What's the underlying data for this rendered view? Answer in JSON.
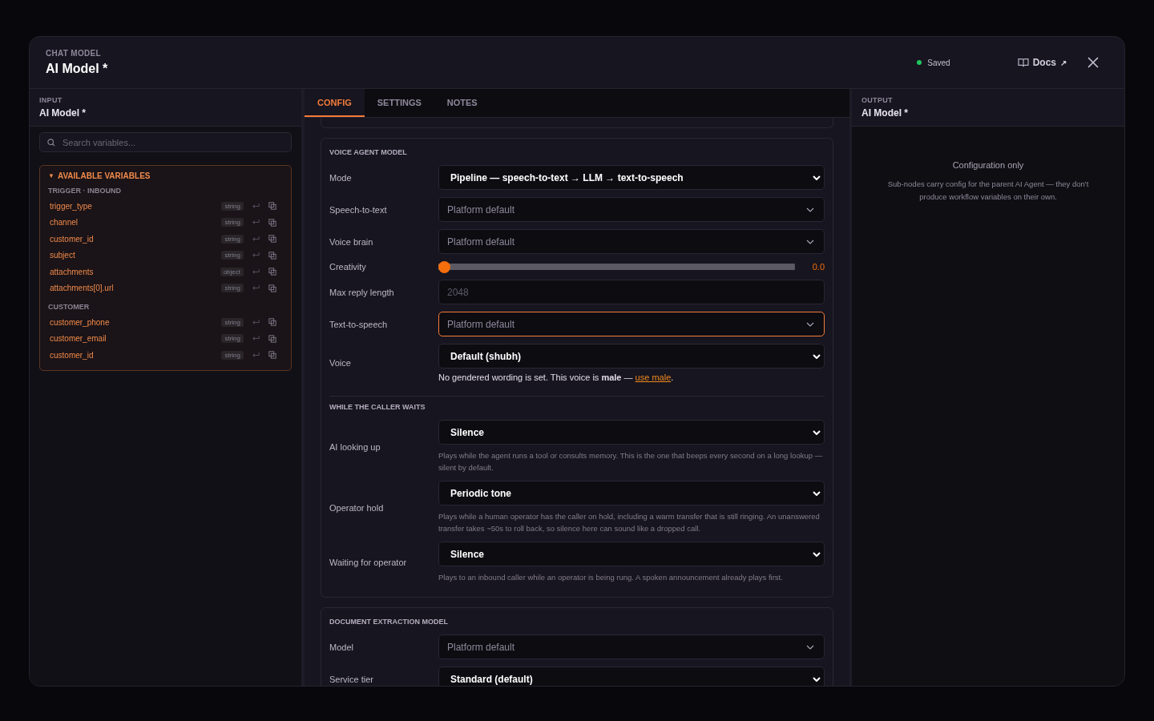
{
  "header": {
    "eyebrow": "CHAT MODEL",
    "title": "AI Model *",
    "status": {
      "label": "Saved",
      "color": "#22c55e"
    },
    "docs": {
      "label": "Docs",
      "arrow": "↗"
    }
  },
  "input_panel": {
    "eyebrow": "INPUT",
    "title": "AI Model *",
    "search": {
      "placeholder": "Search variables..."
    },
    "variables": {
      "caret": "▼",
      "title": "AVAILABLE VARIABLES",
      "expanded": true,
      "groups": [
        {
          "title": "TRIGGER · INBOUND",
          "items": [
            {
              "name": "trigger_type",
              "type": "string"
            },
            {
              "name": "channel",
              "type": "string"
            },
            {
              "name": "customer_id",
              "type": "string"
            },
            {
              "name": "subject",
              "type": "string"
            },
            {
              "name": "attachments",
              "type": "object"
            },
            {
              "name": "attachments[0].url",
              "type": "string"
            }
          ]
        },
        {
          "title": "CUSTOMER",
          "items": [
            {
              "name": "customer_phone",
              "type": "string"
            },
            {
              "name": "customer_email",
              "type": "string"
            },
            {
              "name": "customer_id",
              "type": "string"
            }
          ]
        }
      ]
    }
  },
  "tabs": [
    {
      "label": "CONFIG",
      "selected": true
    },
    {
      "label": "SETTINGS",
      "selected": false
    },
    {
      "label": "NOTES",
      "selected": false
    }
  ],
  "cards": [
    {
      "groups": [
        {
          "title": "VOICE AGENT MODEL",
          "rows": [
            {
              "label": "Mode",
              "kind": "select",
              "value": "Pipeline — speech-to-text → LLM → text-to-speech"
            },
            {
              "label": "Speech-to-text",
              "kind": "select",
              "placeholder": "Platform default"
            },
            {
              "label": "Voice brain",
              "kind": "select",
              "placeholder": "Platform default"
            },
            {
              "label": "Creativity",
              "kind": "slider",
              "level": 0,
              "reading": "0.0"
            },
            {
              "label": "Max reply length",
              "kind": "number",
              "placeholder": "2048"
            },
            {
              "label": "Text-to-speech",
              "kind": "select",
              "placeholder": "Platform default",
              "focused": true
            },
            {
              "label": "Voice",
              "kind": "select",
              "value": "Default (shubh)",
              "note": {
                "text": "No gendered wording is set. This voice is **male** — ",
                "link": "use male",
                "after": "."
              }
            }
          ]
        },
        {
          "title": "WHILE THE CALLER WAITS",
          "rows": [
            {
              "label": "AI looking up",
              "kind": "select",
              "value": "Silence",
              "help": "Plays while the agent runs a tool or consults memory. This is the one that beeps every second on a long lookup — silent by default."
            },
            {
              "label": "Operator hold",
              "kind": "select",
              "value": "Periodic tone",
              "help": "Plays while a human operator has the caller on hold, including a warm transfer that is still ringing. An unanswered transfer takes ~50s to roll back, so silence here can sound like a dropped call."
            },
            {
              "label": "Waiting for operator",
              "kind": "select",
              "value": "Silence",
              "help": "Plays to an inbound caller while an operator is being rung. A spoken announcement already plays first."
            }
          ]
        }
      ]
    },
    {
      "groups": [
        {
          "title": "DOCUMENT EXTRACTION MODEL",
          "rows": [
            {
              "label": "Model",
              "kind": "select",
              "placeholder": "Platform default"
            },
            {
              "label": "Service tier",
              "kind": "select",
              "value": "Standard (default)"
            }
          ]
        }
      ]
    }
  ],
  "output_panel": {
    "eyebrow": "OUTPUT",
    "title": "AI Model *",
    "empty_title": "Configuration only",
    "empty_text": "Sub-nodes carry config for the parent AI Agent — they don't produce workflow variables on their own."
  }
}
